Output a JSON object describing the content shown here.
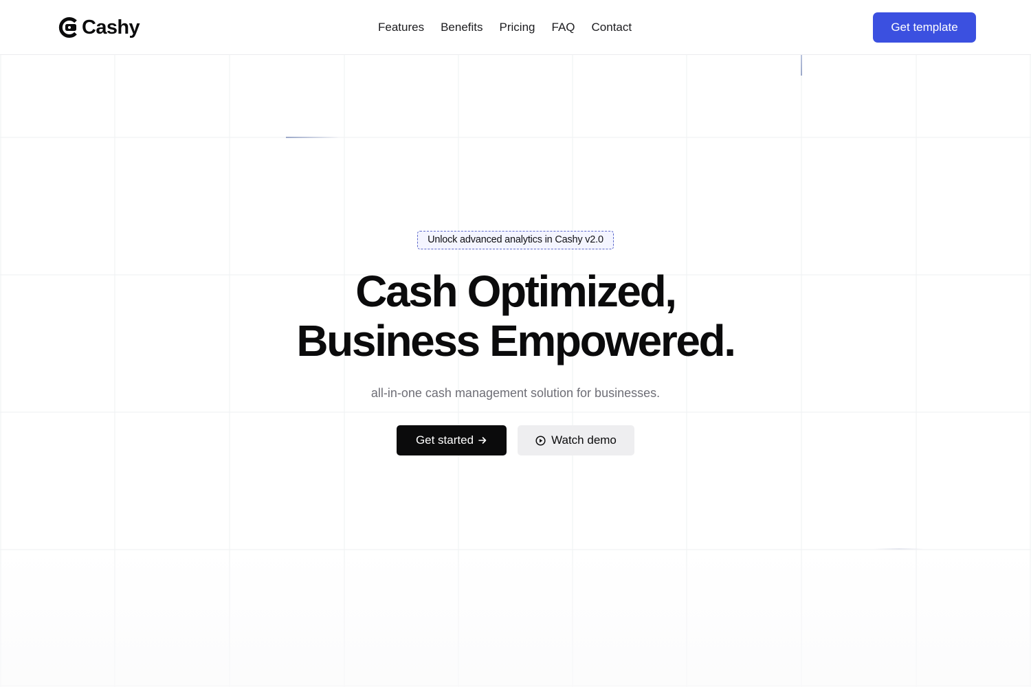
{
  "header": {
    "brand": "Cashy",
    "logo_icon": "cashy-logo-icon",
    "nav": [
      {
        "label": "Features"
      },
      {
        "label": "Benefits"
      },
      {
        "label": "Pricing"
      },
      {
        "label": "FAQ"
      },
      {
        "label": "Contact"
      }
    ],
    "cta_label": "Get template"
  },
  "hero": {
    "badge": "Unlock advanced analytics in Cashy v2.0",
    "headline_line1": "Cash Optimized,",
    "headline_line2": "Business Empowered.",
    "subtitle": "all-in-one cash management solution for businesses.",
    "primary_label": "Get started",
    "primary_icon": "arrow-right-icon",
    "secondary_label": "Watch demo",
    "secondary_icon": "play-circle-icon"
  },
  "colors": {
    "accent": "#3b50e0",
    "primary_button": "#0b0b0c",
    "secondary_button": "#eeeef0",
    "grid_line": "#f1f2f4"
  }
}
